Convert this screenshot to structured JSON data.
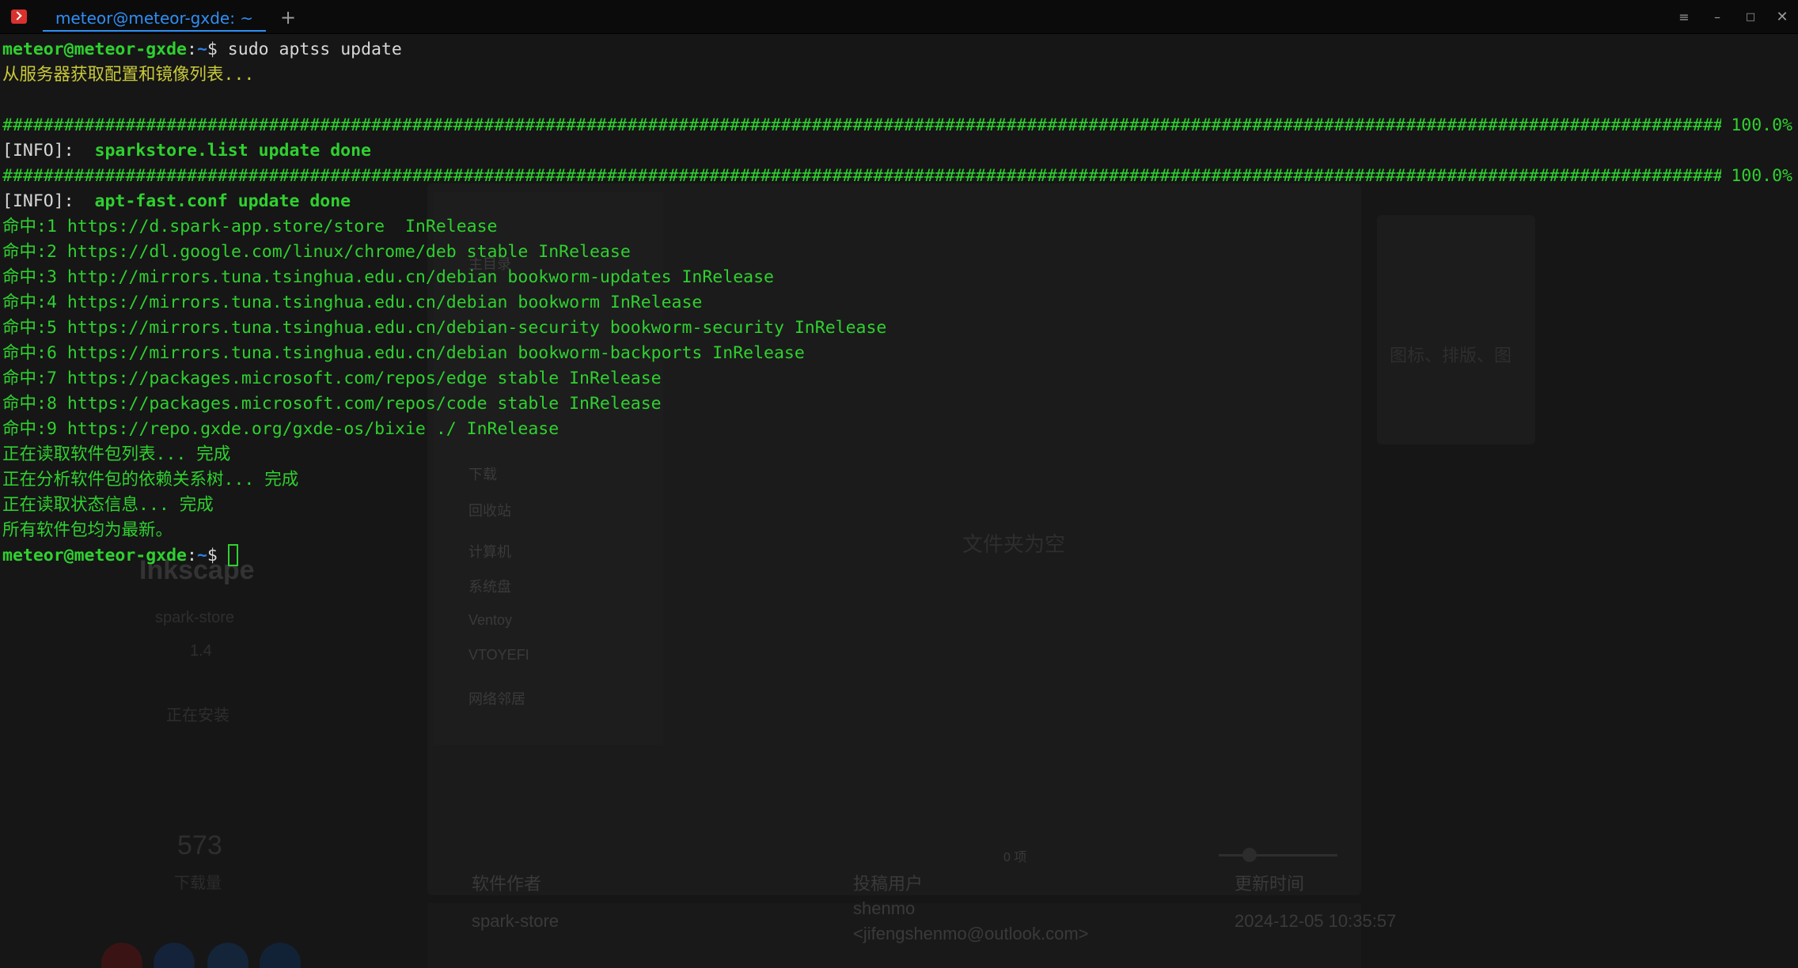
{
  "window": {
    "tab_title": "meteor@meteor-gxde: ~",
    "new_tab": "+",
    "controls": {
      "menu": "≡",
      "minimize": "–",
      "maximize": "□",
      "close": "✕"
    }
  },
  "terminal": {
    "prompt_user": "meteor@meteor-gxde",
    "prompt_path": "~",
    "prompt_sep": ":",
    "prompt_char": "$",
    "command": " sudo aptss update",
    "fetch_msg": "从服务器获取配置和镜像列表...",
    "progress_1": {
      "bar": "############################################################################################################################################################################",
      "pct": "100.0%"
    },
    "info_1": {
      "tag": "[INFO]:",
      "msg": "sparkstore.list update done"
    },
    "progress_2": {
      "bar": "############################################################################################################################################################################",
      "pct": "100.0%"
    },
    "info_2": {
      "tag": "[INFO]:",
      "msg": "apt-fast.conf update done"
    },
    "hits": [
      "命中:1 https://d.spark-app.store/store  InRelease",
      "命中:2 https://dl.google.com/linux/chrome/deb stable InRelease",
      "命中:3 http://mirrors.tuna.tsinghua.edu.cn/debian bookworm-updates InRelease",
      "命中:4 https://mirrors.tuna.tsinghua.edu.cn/debian bookworm InRelease",
      "命中:5 https://mirrors.tuna.tsinghua.edu.cn/debian-security bookworm-security InRelease",
      "命中:6 https://mirrors.tuna.tsinghua.edu.cn/debian bookworm-backports InRelease",
      "命中:7 https://packages.microsoft.com/repos/edge stable InRelease",
      "命中:8 https://packages.microsoft.com/repos/code stable InRelease",
      "命中:9 https://repo.gxde.org/gxde-os/bixie ./ InRelease"
    ],
    "status_lines": [
      "正在读取软件包列表... 完成",
      "正在分析软件包的依赖关系树... 完成",
      "正在读取状态信息... 完成",
      "所有软件包均为最新。"
    ]
  },
  "background_app": {
    "app_name": "Inkscape",
    "source": "spark-store",
    "version": "1.4",
    "action": "正在安装",
    "downloads_count": "573",
    "downloads_label": "下载量",
    "sidebar": [
      "主目录",
      "下载",
      "回收站",
      "计算机",
      "系统盘",
      "Ventoy",
      "VTOYEFI",
      "网络邻居"
    ],
    "empty_folder": "文件夹为空",
    "item_count": "0 项",
    "info_labels": [
      "软件作者",
      "投稿用户",
      "更新时间"
    ],
    "author": "spark-store",
    "contributor_name": "shenmo",
    "contributor_email": "<jifengshenmo@outlook.com>",
    "update_time": "2024-12-05 10:35:57",
    "dialog_hint": "图标、排版、图"
  }
}
